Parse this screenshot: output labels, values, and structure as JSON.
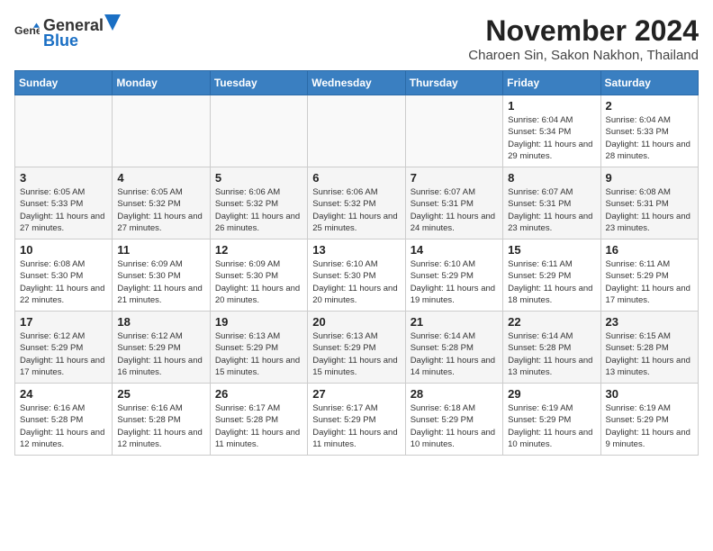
{
  "header": {
    "logo_general": "General",
    "logo_blue": "Blue",
    "title": "November 2024",
    "subtitle": "Charoen Sin, Sakon Nakhon, Thailand"
  },
  "days_of_week": [
    "Sunday",
    "Monday",
    "Tuesday",
    "Wednesday",
    "Thursday",
    "Friday",
    "Saturday"
  ],
  "weeks": [
    [
      {
        "day": "",
        "info": ""
      },
      {
        "day": "",
        "info": ""
      },
      {
        "day": "",
        "info": ""
      },
      {
        "day": "",
        "info": ""
      },
      {
        "day": "",
        "info": ""
      },
      {
        "day": "1",
        "info": "Sunrise: 6:04 AM\nSunset: 5:34 PM\nDaylight: 11 hours and 29 minutes."
      },
      {
        "day": "2",
        "info": "Sunrise: 6:04 AM\nSunset: 5:33 PM\nDaylight: 11 hours and 28 minutes."
      }
    ],
    [
      {
        "day": "3",
        "info": "Sunrise: 6:05 AM\nSunset: 5:33 PM\nDaylight: 11 hours and 27 minutes."
      },
      {
        "day": "4",
        "info": "Sunrise: 6:05 AM\nSunset: 5:32 PM\nDaylight: 11 hours and 27 minutes."
      },
      {
        "day": "5",
        "info": "Sunrise: 6:06 AM\nSunset: 5:32 PM\nDaylight: 11 hours and 26 minutes."
      },
      {
        "day": "6",
        "info": "Sunrise: 6:06 AM\nSunset: 5:32 PM\nDaylight: 11 hours and 25 minutes."
      },
      {
        "day": "7",
        "info": "Sunrise: 6:07 AM\nSunset: 5:31 PM\nDaylight: 11 hours and 24 minutes."
      },
      {
        "day": "8",
        "info": "Sunrise: 6:07 AM\nSunset: 5:31 PM\nDaylight: 11 hours and 23 minutes."
      },
      {
        "day": "9",
        "info": "Sunrise: 6:08 AM\nSunset: 5:31 PM\nDaylight: 11 hours and 23 minutes."
      }
    ],
    [
      {
        "day": "10",
        "info": "Sunrise: 6:08 AM\nSunset: 5:30 PM\nDaylight: 11 hours and 22 minutes."
      },
      {
        "day": "11",
        "info": "Sunrise: 6:09 AM\nSunset: 5:30 PM\nDaylight: 11 hours and 21 minutes."
      },
      {
        "day": "12",
        "info": "Sunrise: 6:09 AM\nSunset: 5:30 PM\nDaylight: 11 hours and 20 minutes."
      },
      {
        "day": "13",
        "info": "Sunrise: 6:10 AM\nSunset: 5:30 PM\nDaylight: 11 hours and 20 minutes."
      },
      {
        "day": "14",
        "info": "Sunrise: 6:10 AM\nSunset: 5:29 PM\nDaylight: 11 hours and 19 minutes."
      },
      {
        "day": "15",
        "info": "Sunrise: 6:11 AM\nSunset: 5:29 PM\nDaylight: 11 hours and 18 minutes."
      },
      {
        "day": "16",
        "info": "Sunrise: 6:11 AM\nSunset: 5:29 PM\nDaylight: 11 hours and 17 minutes."
      }
    ],
    [
      {
        "day": "17",
        "info": "Sunrise: 6:12 AM\nSunset: 5:29 PM\nDaylight: 11 hours and 17 minutes."
      },
      {
        "day": "18",
        "info": "Sunrise: 6:12 AM\nSunset: 5:29 PM\nDaylight: 11 hours and 16 minutes."
      },
      {
        "day": "19",
        "info": "Sunrise: 6:13 AM\nSunset: 5:29 PM\nDaylight: 11 hours and 15 minutes."
      },
      {
        "day": "20",
        "info": "Sunrise: 6:13 AM\nSunset: 5:29 PM\nDaylight: 11 hours and 15 minutes."
      },
      {
        "day": "21",
        "info": "Sunrise: 6:14 AM\nSunset: 5:28 PM\nDaylight: 11 hours and 14 minutes."
      },
      {
        "day": "22",
        "info": "Sunrise: 6:14 AM\nSunset: 5:28 PM\nDaylight: 11 hours and 13 minutes."
      },
      {
        "day": "23",
        "info": "Sunrise: 6:15 AM\nSunset: 5:28 PM\nDaylight: 11 hours and 13 minutes."
      }
    ],
    [
      {
        "day": "24",
        "info": "Sunrise: 6:16 AM\nSunset: 5:28 PM\nDaylight: 11 hours and 12 minutes."
      },
      {
        "day": "25",
        "info": "Sunrise: 6:16 AM\nSunset: 5:28 PM\nDaylight: 11 hours and 12 minutes."
      },
      {
        "day": "26",
        "info": "Sunrise: 6:17 AM\nSunset: 5:28 PM\nDaylight: 11 hours and 11 minutes."
      },
      {
        "day": "27",
        "info": "Sunrise: 6:17 AM\nSunset: 5:29 PM\nDaylight: 11 hours and 11 minutes."
      },
      {
        "day": "28",
        "info": "Sunrise: 6:18 AM\nSunset: 5:29 PM\nDaylight: 11 hours and 10 minutes."
      },
      {
        "day": "29",
        "info": "Sunrise: 6:19 AM\nSunset: 5:29 PM\nDaylight: 11 hours and 10 minutes."
      },
      {
        "day": "30",
        "info": "Sunrise: 6:19 AM\nSunset: 5:29 PM\nDaylight: 11 hours and 9 minutes."
      }
    ]
  ]
}
